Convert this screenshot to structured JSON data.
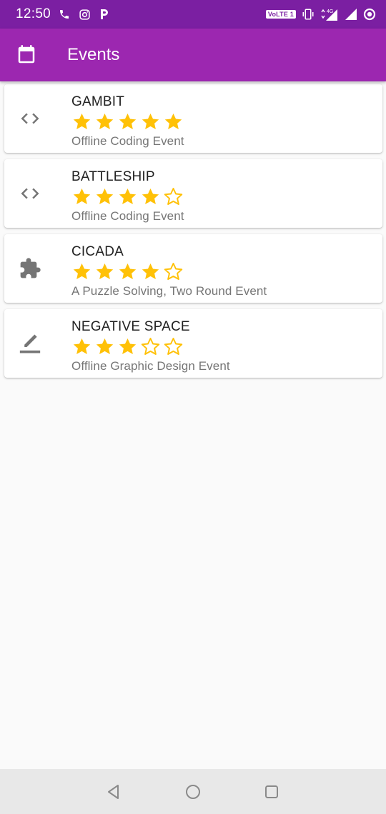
{
  "status_bar": {
    "time": "12:50",
    "network_label": "VoLTE 1",
    "signal_label": "4G"
  },
  "app_bar": {
    "icon": "calendar-icon",
    "title": "Events"
  },
  "events": [
    {
      "title": "GAMBIT",
      "rating": 5,
      "max_rating": 5,
      "subtitle": "Offline Coding Event",
      "icon": "code-icon"
    },
    {
      "title": "BATTLESHIP",
      "rating": 4,
      "max_rating": 5,
      "subtitle": "Offline Coding Event",
      "icon": "code-icon"
    },
    {
      "title": "CICADA",
      "rating": 4,
      "max_rating": 5,
      "subtitle": "A Puzzle Solving, Two Round Event",
      "icon": "puzzle-icon"
    },
    {
      "title": "NEGATIVE SPACE",
      "rating": 3,
      "max_rating": 5,
      "subtitle": "Offline Graphic Design Event",
      "icon": "edit-icon"
    }
  ],
  "colors": {
    "status_bar": "#7b1fa2",
    "app_bar": "#9c27b0",
    "star": "#ffc107",
    "icon": "#757575"
  },
  "nav_bar": {
    "back": "back-icon",
    "home": "home-icon",
    "recents": "recents-icon"
  }
}
